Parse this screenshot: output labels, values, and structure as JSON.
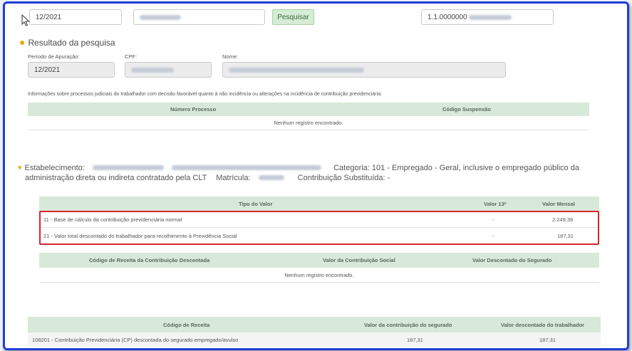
{
  "search": {
    "periodo_value": "12/2021",
    "button_label": "Pesquisar",
    "right_field_value": "1.1.0000000"
  },
  "resultado": {
    "title": "Resultado da pesquisa",
    "periodo_label": "Período de Apuração:",
    "periodo_value": "12/2021",
    "cpf_label": "CPF:",
    "nome_label": "Nome:"
  },
  "processos": {
    "info_text": "Informações sobre processos judiciais do trabalhador com decisão favorável quanto à não incidência ou alterações na incidência de contribuição previdenciária:",
    "headers": [
      "Número Processo",
      "Código Suspensão"
    ],
    "empty_text": "Nenhum registro encontrado."
  },
  "estabelecimento": {
    "label": "Estabelecimento:",
    "categoria_text": "Categoria: 101 - Empregado - Geral, inclusive o empregado público da",
    "line2_text": "administração direta ou indireta contratado pela CLT",
    "matricula_label": "Matrícula:",
    "contribuicao_text": "Contribuição Substituída: -"
  },
  "valores": {
    "headers": [
      "Tipo do Valor",
      "Valor 13º",
      "Valor Mensal"
    ],
    "rows": [
      {
        "tipo": "11 - Base de cálculo da contribuição previdenciária normal",
        "valor13": "-",
        "mensal": "2.249,39"
      },
      {
        "tipo": "21 - Valor total descontado do trabalhador para recolhimento à Previdência Social",
        "valor13": "-",
        "mensal": "187,31"
      }
    ]
  },
  "receita_descontada": {
    "headers": [
      "Código de Receita da Contribuição Descontada",
      "Valor da Contribuição Social",
      "Valor Descontado do Segurado"
    ],
    "empty_text": "Nenhum registro encontrado."
  },
  "receita": {
    "headers": [
      "Código de Receita",
      "Valor da contribuição do segurado",
      "Valor descontado do trabalhador"
    ],
    "rows": [
      {
        "codigo": "108201 - Contribuição Previdenciária (CP) descontada do segurado empregado/avulso",
        "contrib": "187,31",
        "descontado": "187,31"
      }
    ]
  },
  "colors": {
    "frame": "#1f3fd6",
    "table_header": "#d7e9d9",
    "highlight": "#d7242a",
    "bullet": "#f0a800"
  }
}
